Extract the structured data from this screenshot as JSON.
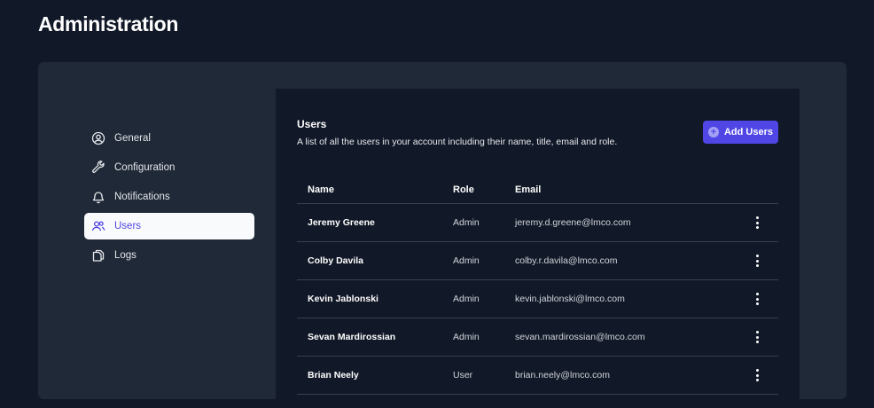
{
  "page": {
    "title": "Administration"
  },
  "sidebar": {
    "items": [
      {
        "label": "General",
        "icon": "user-circle-icon",
        "active": false
      },
      {
        "label": "Configuration",
        "icon": "wrench-icon",
        "active": false
      },
      {
        "label": "Notifications",
        "icon": "bell-icon",
        "active": false
      },
      {
        "label": "Users",
        "icon": "users-icon",
        "active": true
      },
      {
        "label": "Logs",
        "icon": "documents-icon",
        "active": false
      }
    ]
  },
  "users_panel": {
    "title": "Users",
    "description": "A list of all the users in your account including their name, title, email and role.",
    "add_button_label": "Add Users",
    "columns": {
      "name": "Name",
      "role": "Role",
      "email": "Email"
    },
    "rows": [
      {
        "name": "Jeremy Greene",
        "role": "Admin",
        "email": "jeremy.d.greene@lmco.com"
      },
      {
        "name": "Colby Davila",
        "role": "Admin",
        "email": "colby.r.davila@lmco.com"
      },
      {
        "name": "Kevin Jablonski",
        "role": "Admin",
        "email": "kevin.jablonski@lmco.com"
      },
      {
        "name": "Sevan Mardirossian",
        "role": "Admin",
        "email": "sevan.mardirossian@lmco.com"
      },
      {
        "name": "Brian Neely",
        "role": "User",
        "email": "brian.neely@lmco.com"
      }
    ]
  },
  "colors": {
    "background": "#111827",
    "card": "#1f2937",
    "accent": "#4f46e5",
    "active_nav_bg": "#f9fafb"
  }
}
